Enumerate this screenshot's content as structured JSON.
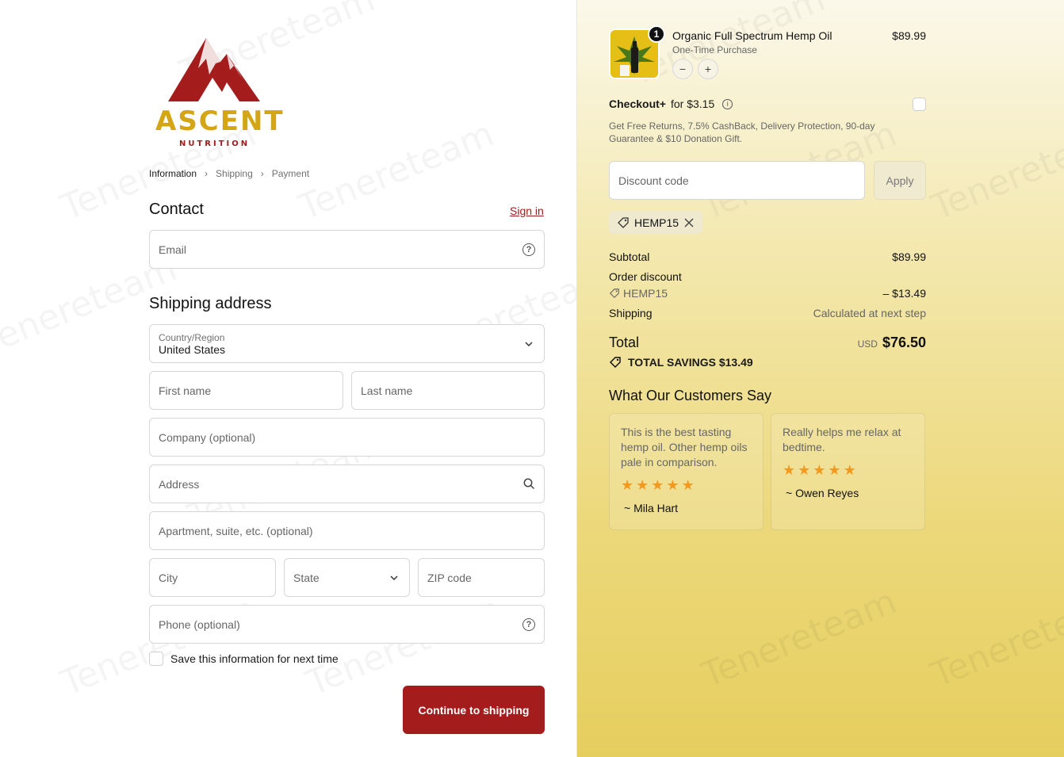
{
  "brand": {
    "name": "ASCENT",
    "tagline": "NUTRITION",
    "colors": {
      "red": "#a51c1c",
      "gold": "#d4a514"
    }
  },
  "breadcrumb": [
    "Information",
    "Shipping",
    "Payment"
  ],
  "contact": {
    "title": "Contact",
    "signin": "Sign in",
    "email_placeholder": "Email"
  },
  "shipping": {
    "title": "Shipping address",
    "country_label": "Country/Region",
    "country_value": "United States",
    "first_name": "First name",
    "last_name": "Last name",
    "company": "Company (optional)",
    "address": "Address",
    "apartment": "Apartment, suite, etc. (optional)",
    "city": "City",
    "state": "State",
    "zip": "ZIP code",
    "phone": "Phone (optional)",
    "save_info": "Save this information for next time",
    "continue": "Continue to shipping"
  },
  "product": {
    "name": "Organic Full Spectrum Hemp Oil",
    "subtitle": "One-Time Purchase",
    "price": "$89.99",
    "quantity": "1",
    "minus": "−",
    "plus": "+"
  },
  "checkout_plus": {
    "label": "Checkout+",
    "price": "for $3.15",
    "description": "Get Free Returns, 7.5% CashBack, Delivery Protection, 90-day Guarantee & $10 Donation Gift."
  },
  "discount": {
    "placeholder": "Discount code",
    "apply": "Apply",
    "code": "HEMP15"
  },
  "summary": {
    "subtotal_label": "Subtotal",
    "subtotal": "$89.99",
    "order_discount_label": "Order discount",
    "discount_code": "HEMP15",
    "discount_amount": "– $13.49",
    "shipping_label": "Shipping",
    "shipping_value": "Calculated at next step",
    "total_label": "Total",
    "currency": "USD",
    "total": "$76.50",
    "savings": "TOTAL SAVINGS $13.49"
  },
  "reviews": {
    "title": "What Our Customers Say",
    "items": [
      {
        "text": "This is the best tasting hemp oil. Other hemp oils pale in comparison.",
        "stars": 5,
        "author": "~ Mila Hart"
      },
      {
        "text": "Really helps me relax at bedtime.",
        "stars": 5,
        "author": "~ Owen Reyes"
      }
    ]
  },
  "watermark": "Tenereteam"
}
